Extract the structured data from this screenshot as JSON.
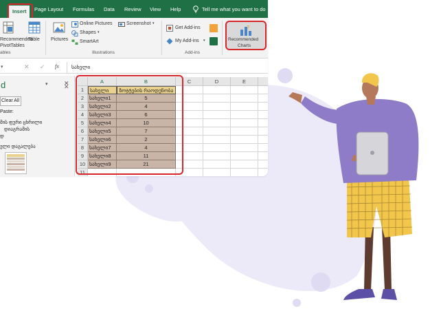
{
  "menu": {
    "tabs": [
      "Insert",
      "Page Layout",
      "Formulas",
      "Data",
      "Review",
      "View",
      "Help"
    ],
    "tell_me": "Tell me what you want to do"
  },
  "ribbon": {
    "recommended_pivottables": [
      "Recommended",
      "PivotTables"
    ],
    "table": "Table",
    "pictures": "Pictures",
    "online_pictures": "Online Pictures",
    "shapes": "Shapes",
    "smartart": "SmartArt",
    "screenshot": "Screenshot",
    "get_addins": "Get Add-ins",
    "my_addins": "My Add-ins",
    "recommended_charts": [
      "Recommended",
      "Charts"
    ],
    "group_tables": "ables",
    "group_illustrations": "Illustrations",
    "group_addins": "Add-ins"
  },
  "formula_bar": {
    "fx": "fx",
    "content": "სახელი"
  },
  "task_pane": {
    "title": "d",
    "clear_all": "Clear All",
    "paste_label": "Paste:",
    "item1": "მის ფური ცხრილი",
    "item2": "დიაგრამის",
    "item3": "დ",
    "item4": "ელი დაგალება"
  },
  "sheet": {
    "columns": [
      "A",
      "B",
      "C",
      "D",
      "E"
    ],
    "rows": [
      "1",
      "2",
      "3",
      "4",
      "5",
      "6",
      "7",
      "8",
      "9",
      "10",
      "11"
    ],
    "header": [
      "სახელი",
      "ზოჯტების რაოდენობა"
    ],
    "data": [
      [
        "სახელი1",
        "5"
      ],
      [
        "სახელი2",
        "4"
      ],
      [
        "სახელი3",
        "6"
      ],
      [
        "სახელი4",
        "10"
      ],
      [
        "სახელი5",
        "7"
      ],
      [
        "სახელი6",
        "2"
      ],
      [
        "სახელი7",
        "4"
      ],
      [
        "სახელი8",
        "11"
      ],
      [
        "სახელი9",
        "21"
      ]
    ]
  },
  "colors": {
    "excel_green": "#1f7145",
    "highlight_red": "#d7262b",
    "header_fill": "#ead28e",
    "data_fill": "#c9b4a8",
    "shirt": "#8f7cc9",
    "shorts": "#f1c64b",
    "blob": "#eceaf8"
  }
}
